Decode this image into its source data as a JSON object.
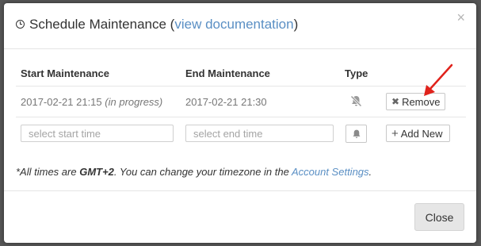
{
  "modal": {
    "title": "Schedule Maintenance (",
    "doc_link": "view documentation",
    "title_end": ")"
  },
  "table": {
    "headers": [
      "Start Maintenance",
      "End Maintenance",
      "Type"
    ],
    "row": {
      "start": "2017-02-21 21:15",
      "status": "(in progress)",
      "end": "2017-02-21 21:30",
      "type_icon": "bell-slash-icon",
      "remove_label": "Remove"
    },
    "new_row": {
      "start_placeholder": "select start time",
      "end_placeholder": "select end time",
      "type_icon": "bell-icon",
      "add_label": "Add New"
    }
  },
  "footnote": {
    "prefix": "*All times are ",
    "tz": "GMT+2",
    "middle": ". You can change your timezone in the ",
    "link": "Account Settings",
    "suffix": "."
  },
  "footer": {
    "close_label": "Close"
  },
  "colors": {
    "link": "#5a8fc4",
    "arrow": "#e0221b"
  }
}
